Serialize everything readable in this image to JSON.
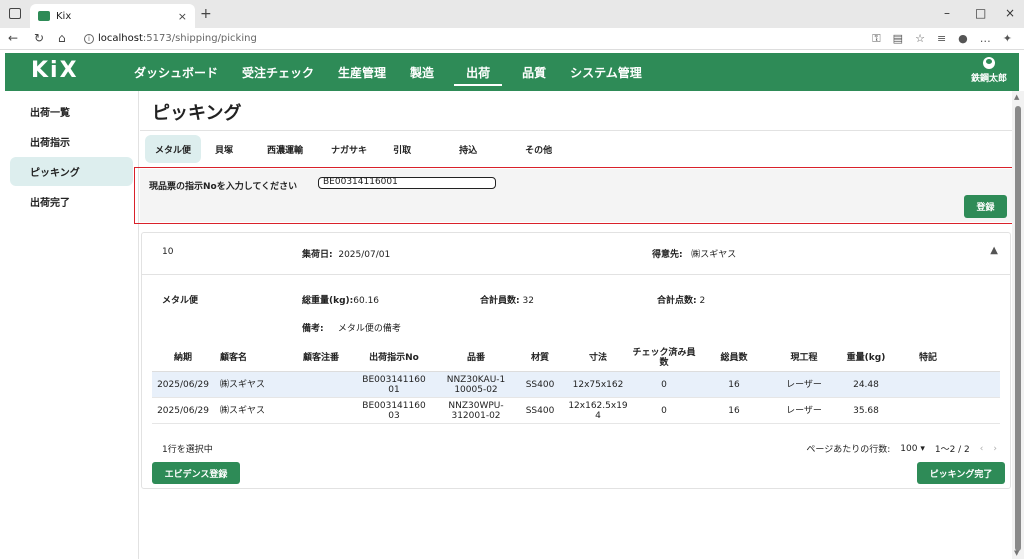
{
  "browser": {
    "tab_title": "Kix",
    "tab_close": "×",
    "new_tab": "+",
    "url_host": "localhost",
    "url_path": ":5173/shipping/picking",
    "win_min": "–",
    "win_max": "□",
    "win_close": "×"
  },
  "app": {
    "logo": "KiX",
    "nav": [
      "ダッシュボード",
      "受注チェック",
      "生産管理",
      "製造",
      "出荷",
      "品質",
      "システム管理"
    ],
    "nav_active": 4,
    "user_name": "鉄鋼太郎"
  },
  "sidebar": {
    "items": [
      "出荷一覧",
      "出荷指示",
      "ピッキング",
      "出荷完了"
    ],
    "active": 2
  },
  "page": {
    "title": "ピッキング",
    "subtabs": [
      "メタル便",
      "貝塚",
      "西濃運輸",
      "ナガサキ",
      "引取",
      "持込",
      "その他"
    ],
    "subtab_active": 0,
    "entry_label": "現品票の指示Noを入力してください",
    "entry_value": "BE00314116001",
    "register_label": "登録"
  },
  "card": {
    "id": "10",
    "pickup_label": "集荷日:",
    "pickup_value": "2025/07/01",
    "customer_label": "得意先:",
    "customer_value": "㈱スギヤス",
    "carrier": "メタル便",
    "weight_label": "総重量(kg):",
    "weight_value": "60.16",
    "total_count_label": "合計員数:",
    "total_count_value": "32",
    "total_points_label": "合計点数:",
    "total_points_value": "2",
    "note_label": "備考:",
    "note_value": "メタル便の備考"
  },
  "table": {
    "headers": [
      "納期",
      "顧客名",
      "顧客注番",
      "出荷指示No",
      "品番",
      "材質",
      "寸法",
      "チェック済み員数",
      "総員数",
      "現工程",
      "重量(kg)",
      "特記"
    ],
    "rows": [
      [
        "2025/06/29",
        "㈱スギヤス",
        "",
        "BE003141160\n01",
        "NNZ30KAU-1\n10005-02",
        "SS400",
        "12x75x162",
        "0",
        "16",
        "レーザー",
        "24.48",
        ""
      ],
      [
        "2025/06/29",
        "㈱スギヤス",
        "",
        "BE003141160\n03",
        "NNZ30WPU-\n312001-02",
        "SS400",
        "12x162.5x19\n4",
        "0",
        "16",
        "レーザー",
        "35.68",
        ""
      ]
    ],
    "selected_row": 0,
    "selection_text": "1行を選択中",
    "rows_per_page_label": "ページあたりの行数:",
    "rows_per_page_value": "100",
    "page_range": "1〜2 / 2"
  },
  "buttons": {
    "evidence": "エビデンス登録",
    "picking_done": "ピッキング完了"
  },
  "colors": {
    "brand": "#2e8b57",
    "highlight": "#d9212a",
    "selected_row": "#e8f0fa"
  }
}
